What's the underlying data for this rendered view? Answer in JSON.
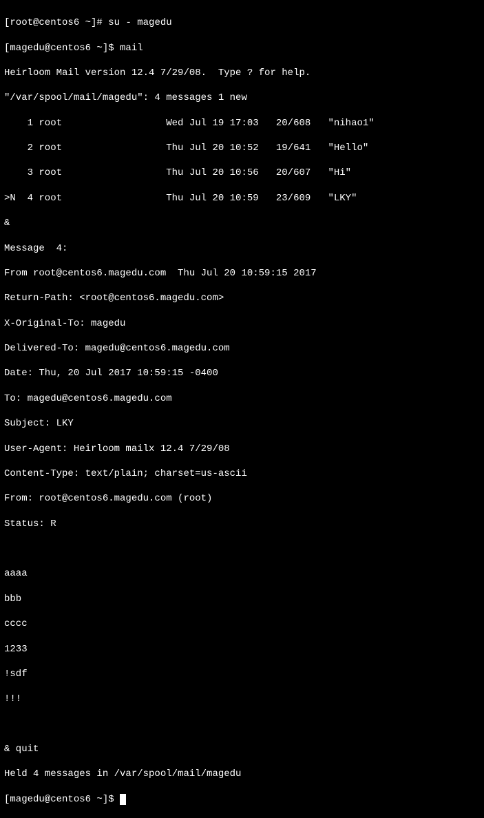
{
  "prompts": {
    "root_prompt": "[root@centos6 ~]# ",
    "user_prompt": "[magedu@centos6 ~]$ ",
    "cmd_su": "su - magedu",
    "cmd_mail": "mail"
  },
  "mail_header": {
    "version": "Heirloom Mail version 12.4 7/29/08.  Type ? for help.",
    "mailbox": "\"/var/spool/mail/magedu\": 4 messages 1 new"
  },
  "messages": {
    "m1": "    1 root                  Wed Jul 19 17:03   20/608   \"nihao1\"",
    "m2": "    2 root                  Thu Jul 20 10:52   19/641   \"Hello\"",
    "m3": "    3 root                  Thu Jul 20 10:56   20/607   \"Hi\"",
    "m4": ">N  4 root                  Thu Jul 20 10:59   23/609   \"LKY\""
  },
  "amp1": "&",
  "msg_detail": {
    "header": "Message  4:",
    "from_line": "From root@centos6.magedu.com  Thu Jul 20 10:59:15 2017",
    "return_path": "Return-Path: <root@centos6.magedu.com>",
    "x_original": "X-Original-To: magedu",
    "delivered": "Delivered-To: magedu@centos6.magedu.com",
    "date": "Date: Thu, 20 Jul 2017 10:59:15 -0400",
    "to": "To: magedu@centos6.magedu.com",
    "subject": "Subject: LKY",
    "user_agent": "User-Agent: Heirloom mailx 12.4 7/29/08",
    "content_type": "Content-Type: text/plain; charset=us-ascii",
    "from2": "From: root@centos6.magedu.com (root)",
    "status": "Status: R"
  },
  "body": {
    "l1": "aaaa",
    "l2": "bbb",
    "l3": "cccc",
    "l4": "1233",
    "l5": "!sdf",
    "l6": "!!!"
  },
  "quit": {
    "amp_quit": "& quit",
    "held": "Held 4 messages in /var/spool/mail/magedu"
  },
  "blank": " "
}
